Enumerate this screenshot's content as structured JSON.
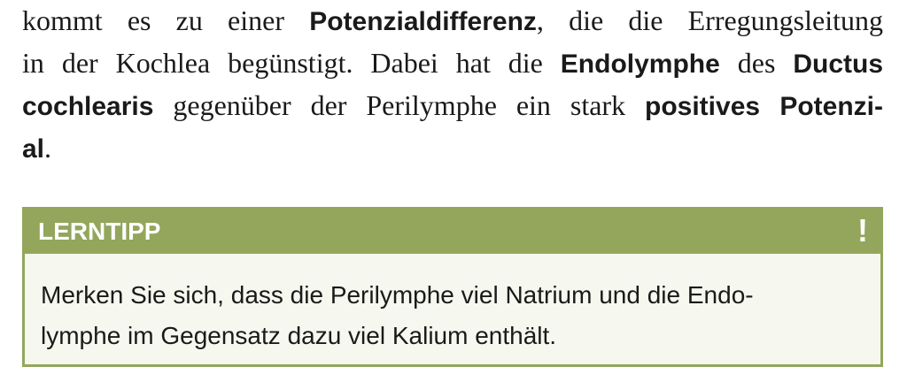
{
  "paragraph": {
    "l1_a": "kommt es zu einer ",
    "l1_b": "Potenzialdifferenz",
    "l1_c": ", die die Erregungsleitung",
    "l2_a": "in der Kochlea begünstigt. Dabei hat die ",
    "l2_b": "Endolymphe",
    "l2_c": " des ",
    "l2_d": "Ductus",
    "l3_a": "cochlearis",
    "l3_b": " gegenüber der Perilymphe ein stark ",
    "l3_c": "positives Potenzi-",
    "l4_a": "al",
    "l4_b": "."
  },
  "tip": {
    "title": "LERNTIPP",
    "icon": "!",
    "line1": "Merken Sie sich, dass die Perilymphe viel Natrium und die Endo-",
    "line2": "lymphe im Gegensatz dazu viel Kalium enthält."
  },
  "colors": {
    "tip_accent": "#93a65c",
    "tip_background": "#f6f7ee",
    "text": "#1a1a1a"
  }
}
